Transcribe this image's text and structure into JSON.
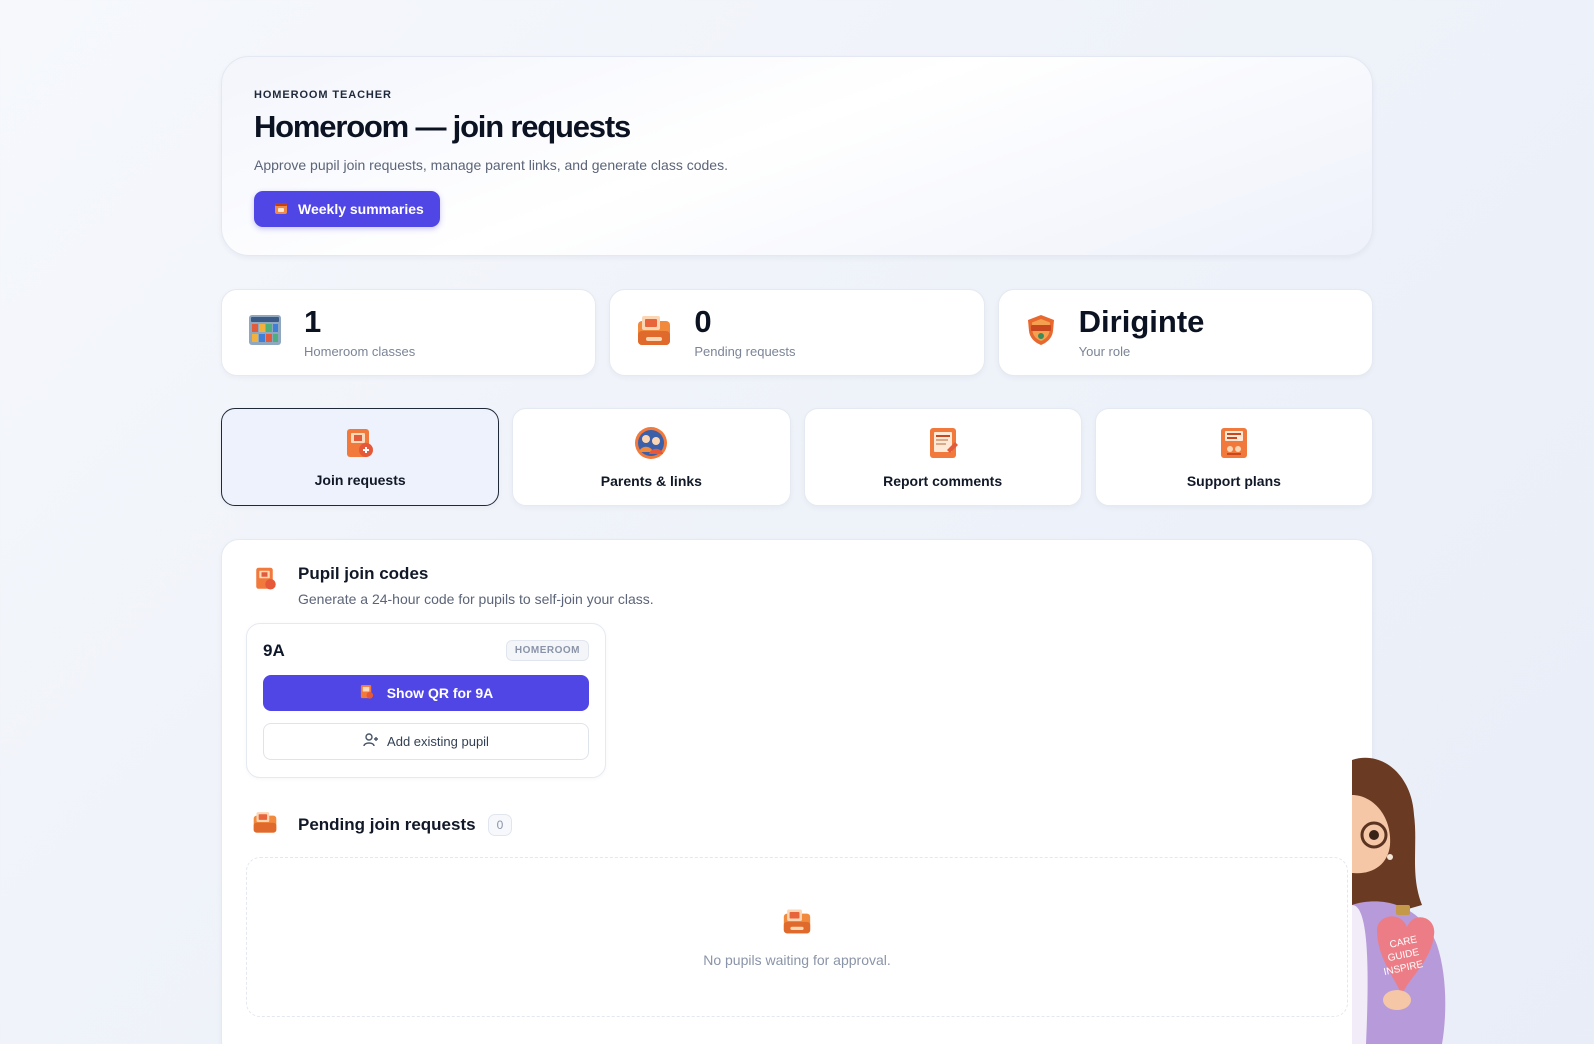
{
  "hero": {
    "eyebrow": "HOMEROOM TEACHER",
    "title": "Homeroom — join requests",
    "subtitle": "Approve pupil join requests, manage parent links, and generate class codes.",
    "button_label": "Weekly summaries"
  },
  "stats": [
    {
      "value": "1",
      "label": "Homeroom classes",
      "icon": "bookshelf-icon"
    },
    {
      "value": "0",
      "label": "Pending requests",
      "icon": "inbox-tray-icon"
    },
    {
      "value": "Diriginte",
      "label": "Your role",
      "icon": "shield-badge-icon"
    }
  ],
  "tabs": [
    {
      "label": "Join requests",
      "icon": "door-join-icon",
      "active": true
    },
    {
      "label": "Parents & links",
      "icon": "people-link-icon",
      "active": false
    },
    {
      "label": "Report comments",
      "icon": "report-note-icon",
      "active": false
    },
    {
      "label": "Support plans",
      "icon": "support-plan-icon",
      "active": false
    }
  ],
  "join_codes": {
    "title": "Pupil join codes",
    "subtitle": "Generate a 24-hour code for pupils to self-join your class.",
    "class_name": "9A",
    "badge": "HOMEROOM",
    "qr_button": "Show QR for 9A",
    "add_button": "Add existing pupil"
  },
  "pending": {
    "title": "Pending join requests",
    "count": "0",
    "empty_text": "No pupils waiting for approval."
  },
  "mascot": {
    "sign_lines": [
      "CARE",
      "GUIDE",
      "INSPIRE"
    ]
  },
  "colors": {
    "accent": "#4f46e5",
    "icon_orange": "#f07a3a"
  }
}
